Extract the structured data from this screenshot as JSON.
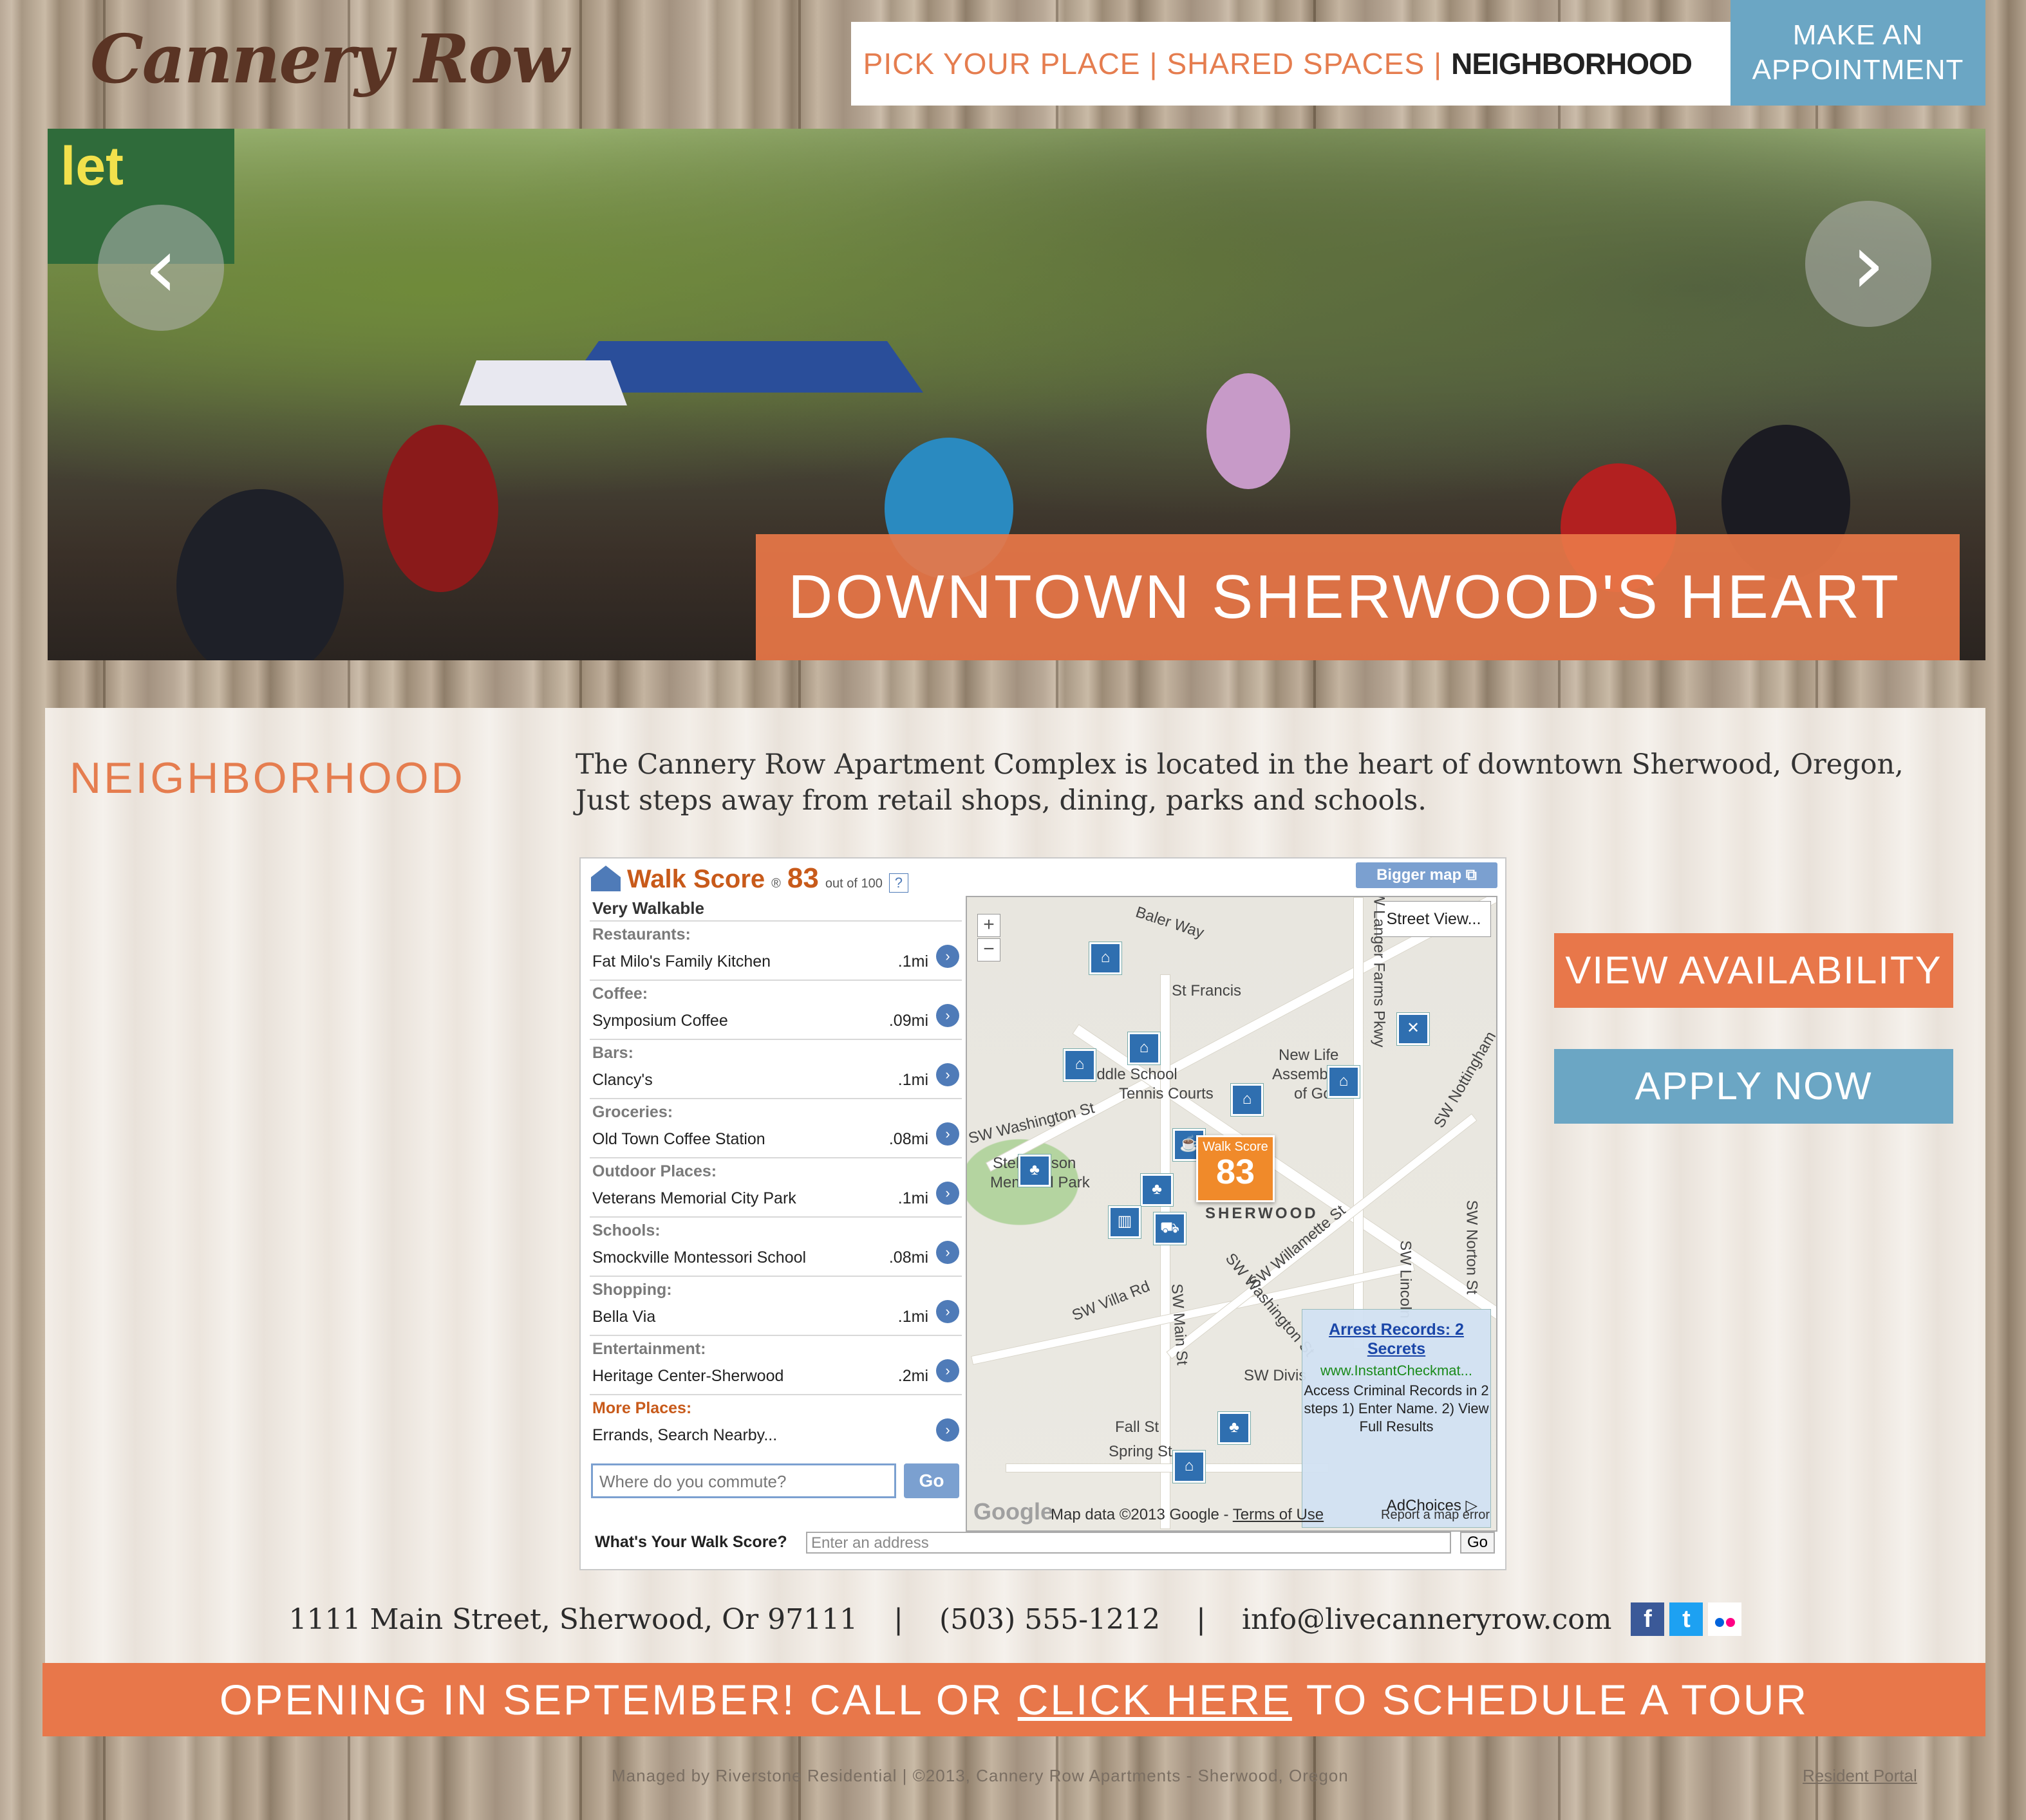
{
  "header": {
    "logo": "Cannery Row",
    "nav": [
      {
        "label": "PICK YOUR PLACE"
      },
      {
        "label": "SHARED SPACES"
      },
      {
        "label": "NEIGHBORHOOD"
      }
    ],
    "nav_separator": "|",
    "appointment_line1": "MAKE AN",
    "appointment_line2": "APPOINTMENT"
  },
  "hero": {
    "sign_text": "let",
    "caption": "DOWNTOWN SHERWOOD'S HEART",
    "prev_icon": "chevron-left-icon",
    "next_icon": "chevron-right-icon"
  },
  "main": {
    "section_title": "NEIGHBORHOOD",
    "intro_line1": "The Cannery Row Apartment Complex is located in the heart of downtown Sherwood, Oregon,",
    "intro_line2": "Just steps away from retail shops, dining, parks and schools."
  },
  "walkscore": {
    "title": "Walk Score",
    "registered": "®",
    "score": "83",
    "out_of": "out of 100",
    "help": "?",
    "rating": "Very Walkable",
    "bigger_map": "Bigger map",
    "categories": [
      {
        "category": "Restaurants:",
        "name": "Fat Milo's Family Kitchen",
        "distance": ".1mi"
      },
      {
        "category": "Coffee:",
        "name": "Symposium Coffee",
        "distance": ".09mi"
      },
      {
        "category": "Bars:",
        "name": "Clancy's",
        "distance": ".1mi"
      },
      {
        "category": "Groceries:",
        "name": "Old Town Coffee Station",
        "distance": ".08mi"
      },
      {
        "category": "Outdoor Places:",
        "name": "Veterans Memorial City Park",
        "distance": ".1mi"
      },
      {
        "category": "Schools:",
        "name": "Smockville Montessori School",
        "distance": ".08mi"
      },
      {
        "category": "Shopping:",
        "name": "Bella Via",
        "distance": ".1mi"
      },
      {
        "category": "Entertainment:",
        "name": "Heritage Center-Sherwood",
        "distance": ".2mi"
      },
      {
        "category": "More Places:",
        "name": "Errands, Search Nearby...",
        "distance": ""
      }
    ],
    "commute_placeholder": "Where do you commute?",
    "go": "Go",
    "footer_label": "What's Your Walk Score?",
    "address_placeholder": "Enter an address",
    "address_go": "Go"
  },
  "map": {
    "street_view": "Street View...",
    "zoom_in": "+",
    "zoom_out": "−",
    "marker_label": "Walk Score",
    "marker_score": "83",
    "labels": {
      "baler_way": "Baler Way",
      "st_francis": "St Francis",
      "new_life": "New Life",
      "assembly": "Assembly",
      "of_god": "of God",
      "middle_school": "Middle School",
      "tennis": "Tennis Courts",
      "washington": "SW Washington St",
      "stella": "Stella Olson",
      "memorial_park": "Memorial Park",
      "sherwood": "SHERWOOD",
      "villa": "SW Villa Rd",
      "main": "SW Main St",
      "willamette": "SW Willamette St",
      "washington2": "SW Washington St",
      "division": "SW Divis",
      "fall": "Fall St",
      "spring": "Spring St",
      "langer": "SW Langer Farms Pkwy",
      "norton": "SW Norton St",
      "lincoln": "SW Lincoln",
      "nottingham": "SW Nottingham"
    },
    "ad_title": "Arrest Records: 2 Secrets",
    "ad_url": "www.InstantCheckmat...",
    "ad_body": "Access Criminal Records in 2 steps 1) Enter Name. 2) View Full Results",
    "ad_choices": "AdChoices",
    "credit": "Map data ©2013 Google - ",
    "terms": "Terms of Use",
    "report": "Report a map error",
    "google": "Google"
  },
  "cta": {
    "availability": "VIEW AVAILABILITY",
    "apply": "APPLY NOW"
  },
  "contact": {
    "address": "1111 Main Street,  Sherwood, Or 97111",
    "separator": "|",
    "phone": "(503) 555-1212",
    "email": "info@livecanneryrow.com",
    "facebook": "f",
    "twitter": "t"
  },
  "banner": {
    "prefix": "OPENING IN SEPTEMBER! CALL OR",
    "link": "CLICK HERE",
    "suffix": "TO SCHEDULE A TOUR"
  },
  "footer": {
    "note": "Managed by Riverstone Residential | ©2013, Cannery Row Apartments - Sherwood, Oregon",
    "resident_portal": "Resident Portal"
  },
  "colors": {
    "accent_orange": "#e8774a",
    "accent_blue": "#6ba6c4",
    "logo_brown": "#5a3424"
  }
}
